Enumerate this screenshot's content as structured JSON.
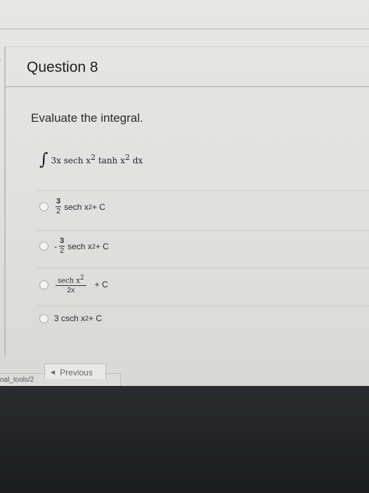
{
  "question": {
    "title": "Question 8",
    "prompt": "Evaluate the integral.",
    "integral": {
      "sign": "∫",
      "coef": "3x sech x",
      "exp1": "2",
      "mid": " tanh x",
      "exp2": "2",
      "tail": " dx"
    },
    "options": [
      {
        "numerator": "3",
        "denominator": "2",
        "text": "sech x",
        "exp": "2",
        "suffix": " + C"
      },
      {
        "sign": "-",
        "numerator": "3",
        "denominator": "2",
        "text": "sech x",
        "exp": "2",
        "suffix": " + C"
      },
      {
        "numerator_text": "sech x",
        "numerator_exp": "2",
        "denominator": "2x",
        "suffix": "+ C"
      },
      {
        "text": "3 csch x",
        "exp": "2",
        "suffix": " + C"
      }
    ]
  },
  "nav": {
    "previous_label": "Previous"
  },
  "status_bar": {
    "url_fragment": "nal_tools/2"
  },
  "icons": {
    "nav_arrow": "chevron-right-icon",
    "previous_arrow": "triangle-left-icon"
  }
}
